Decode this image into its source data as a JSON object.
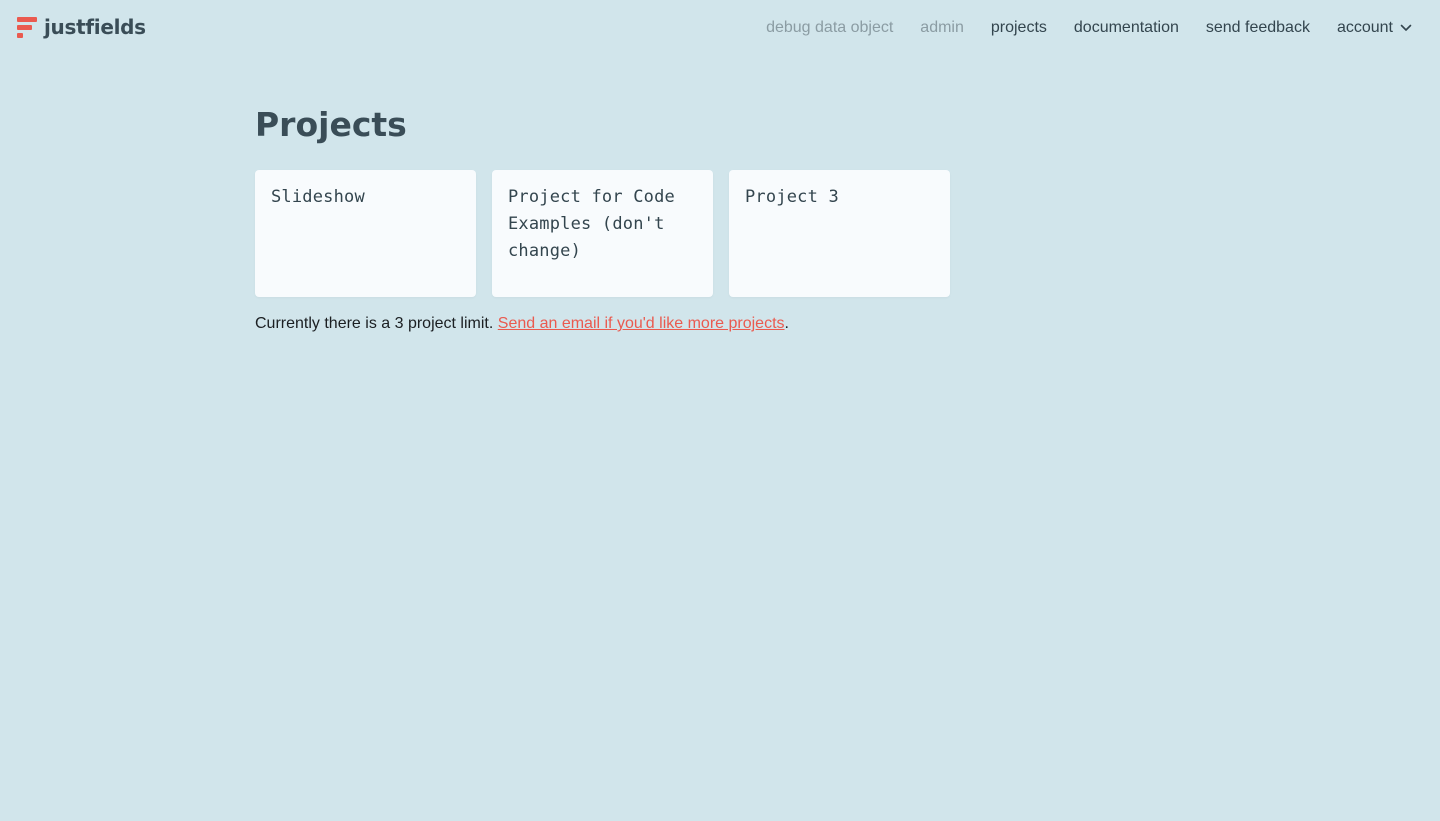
{
  "brand": {
    "name": "justfields",
    "logo_icon": "justfields-logo-icon",
    "accent_color": "#ea5a4f"
  },
  "nav": {
    "debug": "debug data object",
    "admin": "admin",
    "projects": "projects",
    "documentation": "documentation",
    "feedback": "send feedback",
    "account": "account"
  },
  "page": {
    "title": "Projects"
  },
  "projects": [
    {
      "name": "Slideshow"
    },
    {
      "name": "Project for Code Examples (don't change)"
    },
    {
      "name": "Project 3"
    }
  ],
  "limit_note": {
    "text": "Currently there is a 3 project limit.",
    "link": "Send an email if you'd like more projects",
    "suffix": "."
  }
}
